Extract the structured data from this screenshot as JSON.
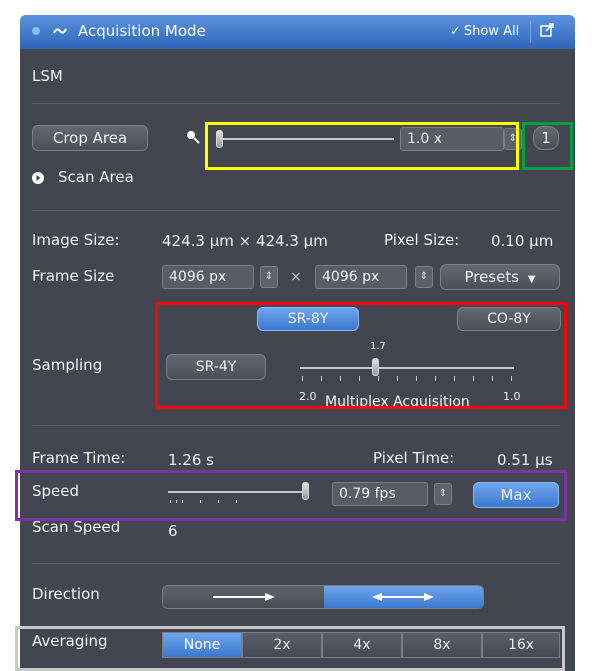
{
  "titlebar": {
    "title": "Acquisition Mode",
    "show_all": "Show All",
    "show_all_checked": true
  },
  "lsm_label": "LSM",
  "crop": {
    "crop_area_label": "Crop Area",
    "scan_area_label": "Scan Area",
    "zoom_value": "1.0 x",
    "zoom_reset_label": "1",
    "zoom_level": 1.0
  },
  "image": {
    "image_size_label": "Image Size:",
    "image_size_value": "424.3 µm × 424.3 µm",
    "pixel_size_label": "Pixel Size:",
    "pixel_size_value": "0.10 µm",
    "frame_size_label": "Frame Size",
    "frame_x": "4096 px",
    "frame_times": "×",
    "frame_y": "4096 px",
    "presets_label": "Presets"
  },
  "sampling": {
    "label": "Sampling",
    "sr8y": "SR-8Y",
    "co8y": "CO-8Y",
    "sr4y": "SR-4Y",
    "slider_value": "1.7",
    "scale_left": "2.0",
    "scale_right": "1.0",
    "multiplex_label": "Multiplex Acquisition"
  },
  "timing": {
    "frame_time_label": "Frame Time:",
    "frame_time_value": "1.26 s",
    "pixel_time_label": "Pixel Time:",
    "pixel_time_value": "0.51 µs",
    "speed_label": "Speed",
    "speed_value": "0.79 fps",
    "max_label": "Max",
    "scan_speed_label": "Scan Speed",
    "scan_speed_value": "6"
  },
  "direction": {
    "label": "Direction",
    "selected": "bidirectional"
  },
  "averaging": {
    "label": "Averaging",
    "options": [
      "None",
      "2x",
      "4x",
      "8x",
      "16x"
    ],
    "selected": "None"
  },
  "colors": {
    "panel_bg": "#434650",
    "title_blue": "#3b74c8",
    "highlight_yellow": "#ffff00",
    "highlight_green": "#00a040",
    "highlight_red": "#ff0000",
    "highlight_purple": "#7a35a0",
    "highlight_gray": "#c8c8c8"
  }
}
